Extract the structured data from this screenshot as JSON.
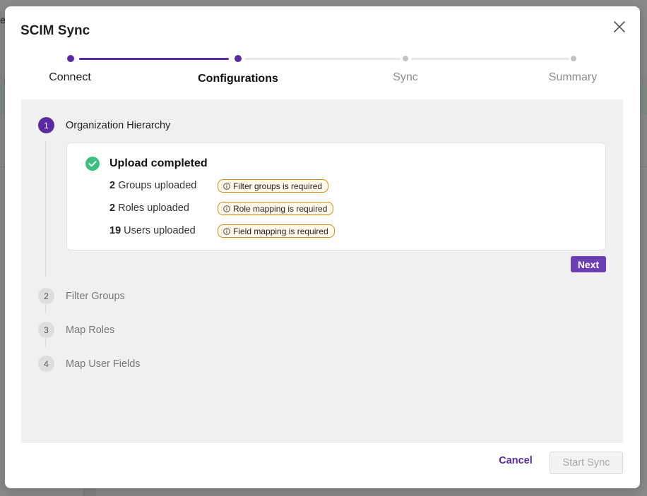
{
  "background": {
    "edge_text": "e"
  },
  "modal": {
    "title": "SCIM Sync",
    "accent_color": "#5b2aa3"
  },
  "stepper": {
    "steps": [
      {
        "label": "Connect",
        "state": "done"
      },
      {
        "label": "Configurations",
        "state": "current"
      },
      {
        "label": "Sync",
        "state": "todo"
      },
      {
        "label": "Summary",
        "state": "todo"
      }
    ]
  },
  "sections": [
    {
      "number": "1",
      "title": "Organization Hierarchy",
      "state": "active"
    },
    {
      "number": "2",
      "title": "Filter Groups",
      "state": "inactive"
    },
    {
      "number": "3",
      "title": "Map Roles",
      "state": "inactive"
    },
    {
      "number": "4",
      "title": "Map User Fields",
      "state": "inactive"
    }
  ],
  "upload_card": {
    "title": "Upload completed",
    "icon": "check-circle-icon",
    "success_color": "#3fbf7f",
    "stats": [
      {
        "count": "2",
        "label": "Groups uploaded",
        "badge": "Filter groups is required"
      },
      {
        "count": "2",
        "label": "Roles uploaded",
        "badge": "Role mapping is required"
      },
      {
        "count": "19",
        "label": "Users uploaded",
        "badge": "Field mapping is required"
      }
    ]
  },
  "next_label": "Next",
  "footer": {
    "cancel_label": "Cancel",
    "start_label": "Start Sync"
  }
}
